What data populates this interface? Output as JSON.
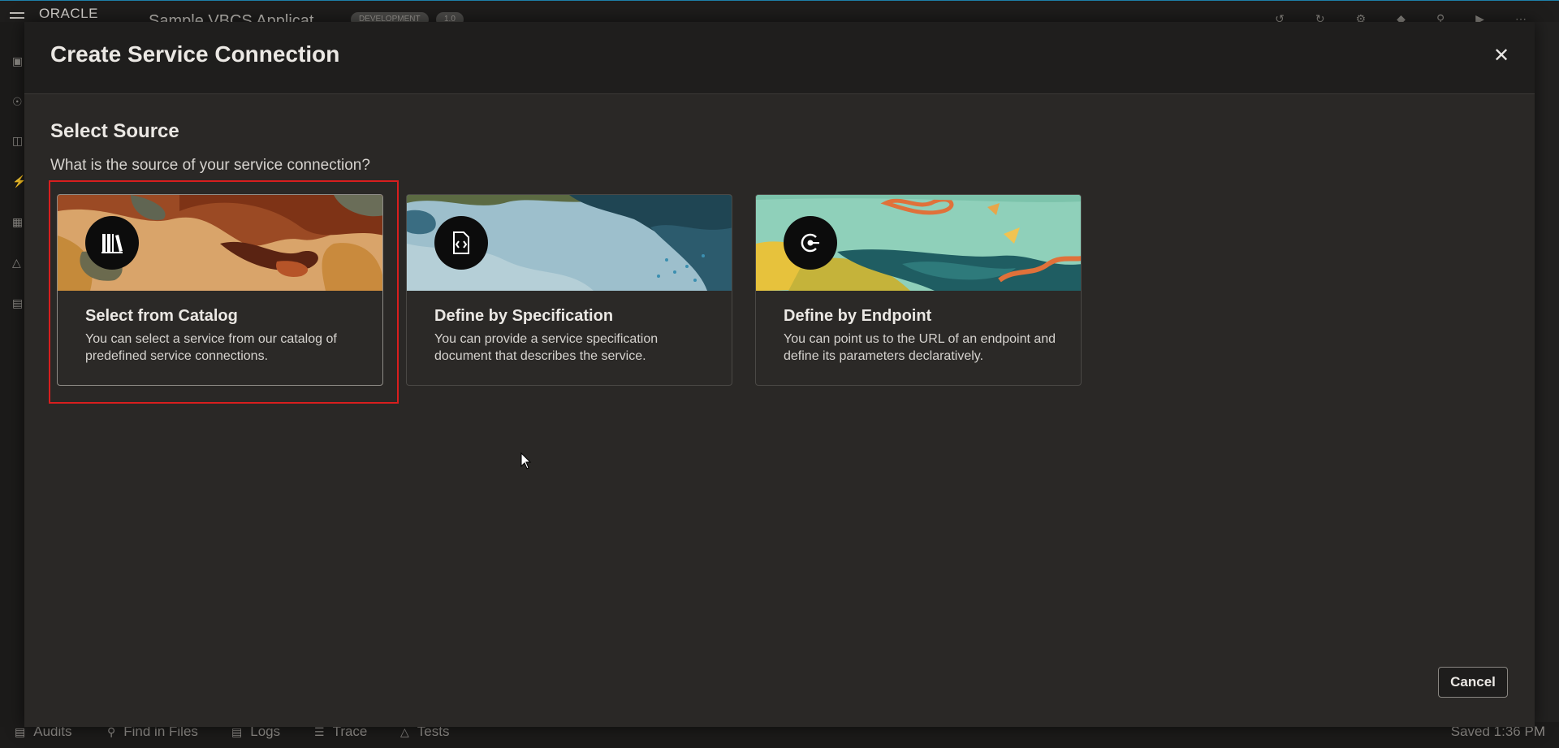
{
  "app": {
    "logo": "ORACLE",
    "title": "Sample VBCS Applicat",
    "pill1": "DEVELOPMENT",
    "pill2": "1.0"
  },
  "bottom_tabs": [
    {
      "label": "Audits",
      "icon": "audits-icon"
    },
    {
      "label": "Find in Files",
      "icon": "search-icon"
    },
    {
      "label": "Logs",
      "icon": "logs-icon"
    },
    {
      "label": "Trace",
      "icon": "trace-icon"
    },
    {
      "label": "Tests",
      "icon": "tests-icon"
    }
  ],
  "status": {
    "saved": "Saved 1:36 PM"
  },
  "modal": {
    "title": "Create Service Connection",
    "close_icon": "close-icon",
    "section_title": "Select Source",
    "section_subtitle": "What is the source of your service connection?",
    "cancel_label": "Cancel",
    "options": [
      {
        "title": "Select from Catalog",
        "description": "You can select a service from our catalog of predefined service connections.",
        "icon": "catalog-books-icon",
        "selected": true
      },
      {
        "title": "Define by Specification",
        "description": "You can provide a service specification document that describes the service.",
        "icon": "document-code-icon",
        "selected": false
      },
      {
        "title": "Define by Endpoint",
        "description": "You can point us to the URL of an endpoint and define its parameters declaratively.",
        "icon": "endpoint-icon",
        "selected": false
      }
    ]
  },
  "colors": {
    "modal_bg": "#2a2826",
    "header_bg": "#1f1e1d",
    "focus_ring": "#d81e1e",
    "text": "#ebe8e4"
  }
}
